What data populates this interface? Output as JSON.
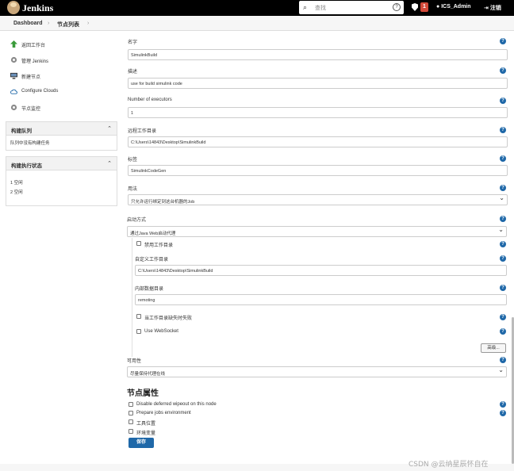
{
  "header": {
    "brand": "Jenkins",
    "search_placeholder": "查找",
    "help": "?",
    "alert_count": "1",
    "user": "ICS_Admin",
    "logout": "注销"
  },
  "breadcrumb": {
    "dashboard": "Dashboard",
    "sep1": "›",
    "nodes": "节点列表",
    "sep2": "›"
  },
  "sidebar": {
    "tasks": [
      {
        "label": "返回工作台",
        "icon": "up-arrow-icon",
        "color": "#3a9b3a"
      },
      {
        "label": "管理 Jenkins",
        "icon": "gear-icon",
        "color": "#777777"
      },
      {
        "label": "新建节点",
        "icon": "computer-icon",
        "color": "#333333"
      },
      {
        "label": "Configure Clouds",
        "icon": "cloud-icon",
        "color": "#1f68a8"
      },
      {
        "label": "节点监控",
        "icon": "gear-icon",
        "color": "#777777"
      }
    ],
    "queue": {
      "title": "构建队列",
      "toggle": "⌃",
      "empty": "队列中没有构建任务"
    },
    "executors": {
      "title": "构建执行状态",
      "toggle": "⌃",
      "rows": [
        "1 空闲",
        "2 空闲"
      ]
    }
  },
  "form": {
    "name": {
      "label": "名字",
      "value": "SimulinkBuild"
    },
    "description": {
      "label": "描述",
      "value": "use for build simulink code"
    },
    "executors": {
      "label": "Number of executors",
      "value": "1"
    },
    "remote_root": {
      "label": "远程工作目录",
      "value": "C:\\Users\\14843\\Desktop\\SimulinkBuild"
    },
    "labels": {
      "label": "标签",
      "value": "SimulinkCodeGen"
    },
    "usage": {
      "label": "用法",
      "value": "只允许运行绑定到这台机器的Job"
    },
    "launch": {
      "label": "启动方式",
      "value": "通过Java Web启动代理"
    },
    "disable_workdir": {
      "label": "禁用工作目录"
    },
    "custom_workdir": {
      "label": "自定义工作目录",
      "value": "C:\\Users\\14843\\Desktop\\SimulinkBuild"
    },
    "internal_dir": {
      "label": "内部数据目录",
      "value": "remoting"
    },
    "fail_missing": {
      "label": "当工作目录缺失时失败"
    },
    "websocket": {
      "label": "Use WebSocket"
    },
    "advanced": "高级...",
    "availability": {
      "label": "可用性",
      "value": "尽量保持代理在线"
    },
    "node_props_title": "节点属性",
    "props": [
      "Disable deferred wipeout on this node",
      "Prepare jobs environment",
      "工具位置",
      "环境变量"
    ],
    "save": "保存"
  },
  "watermark": "CSDN @云纳星辰怀自在",
  "help_icon": "?"
}
